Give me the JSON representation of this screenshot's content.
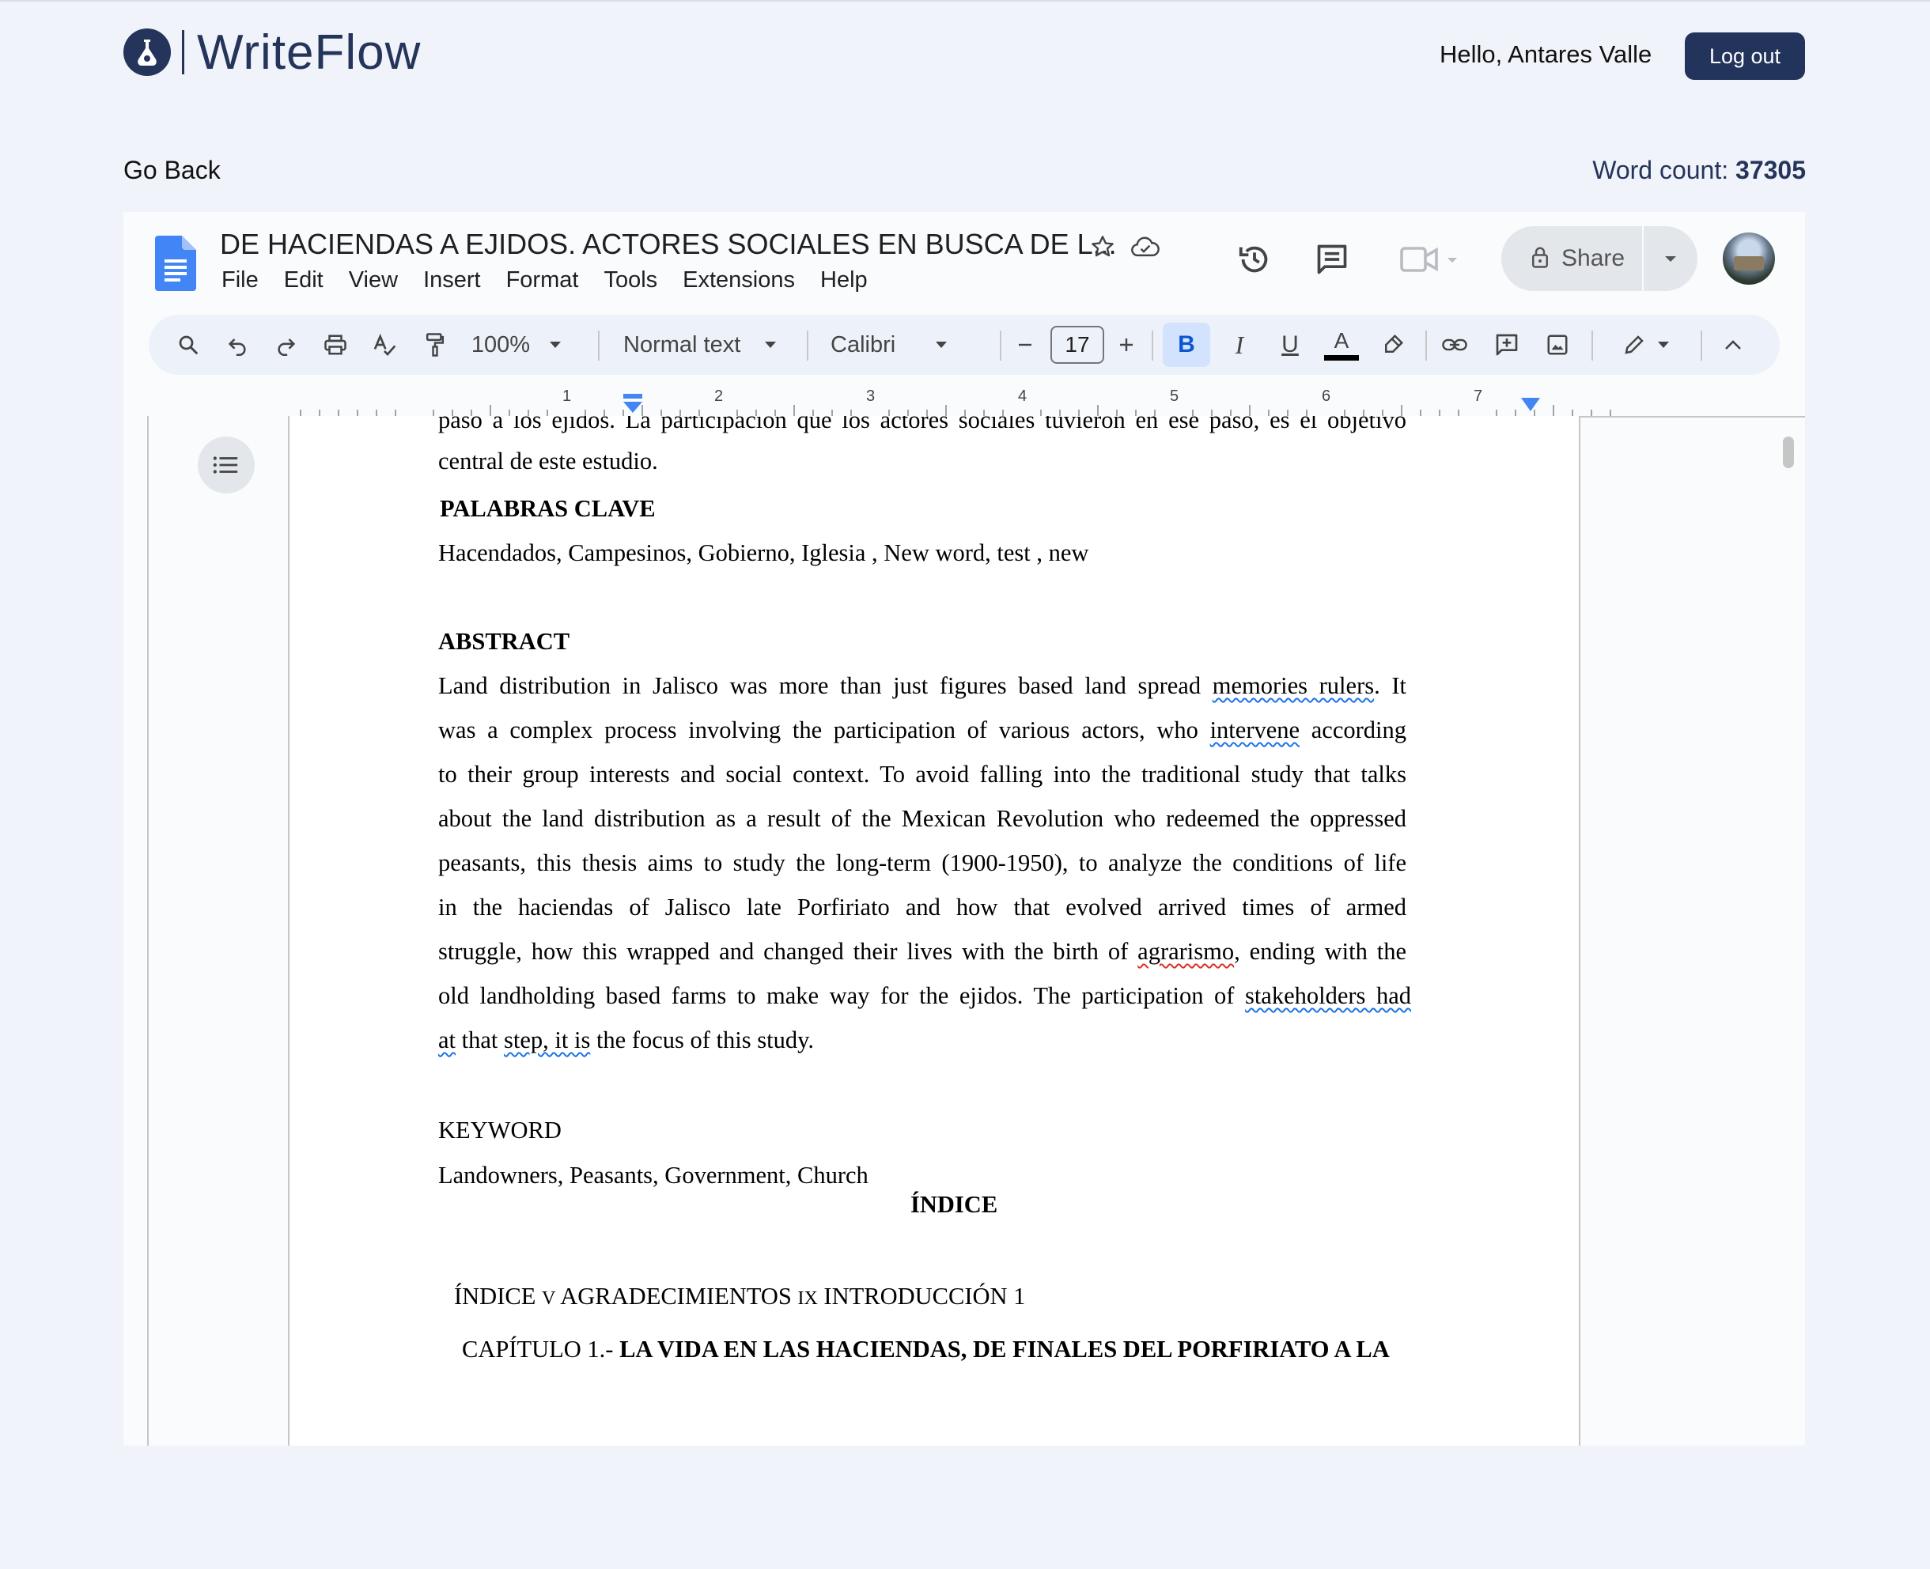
{
  "app": {
    "brand_name": "WriteFlow",
    "greeting": "Hello, Antares Valle",
    "logout_label": "Log out",
    "go_back_label": "Go Back",
    "word_count_label": "Word count:",
    "word_count_value": "37305"
  },
  "editor": {
    "doc_title": "DE HACIENDAS A EJIDOS. ACTORES SOCIALES EN BUSCA DE L...",
    "menu": [
      "File",
      "Edit",
      "View",
      "Insert",
      "Format",
      "Tools",
      "Extensions",
      "Help"
    ],
    "share_label": "Share",
    "toolbar": {
      "zoom": "100%",
      "style": "Normal text",
      "font": "Calibri",
      "font_size": "17"
    },
    "ruler_numbers": [
      "1",
      "2",
      "3",
      "4",
      "5",
      "6",
      "7"
    ],
    "icons": {
      "doc": "docs-file-icon",
      "star": "star-icon",
      "cloud": "cloud-saved-icon",
      "history": "version-history-icon",
      "comments": "comments-icon",
      "meet": "video-call-icon",
      "lock": "lock-icon",
      "outline": "document-outline-icon"
    },
    "colors": {
      "accent": "#1a73e8",
      "brand": "#24345a",
      "toolbar_bg": "#edf2fa",
      "bold_active": "#d3e3fd"
    }
  },
  "document": {
    "line_top_cut": "paso a los  ejidos. La participación que los actores sociales tuvieron en ese paso, es el objetivo",
    "line_central": "central de  este estudio.",
    "palabras_heading": "PALABRAS CLAVE",
    "palabras_text": "Hacendados, Campesinos, Gobierno, Iglesia , New word, test , new",
    "abstract_heading": "ABSTRACT",
    "abstract": {
      "l1_a": "Land distribution in Jalisco was more than just figures based land spread ",
      "l1_b": "memories rulers",
      "l1_c": ". It",
      "l2_a": "was a complex process involving the participation of various actors, who ",
      "l2_b": "intervene",
      "l2_c": " according",
      "l3": "to their group interests and social context. To avoid falling into the traditional study that talks",
      "l4": "about the land distribution as a result of the Mexican Revolution who redeemed the oppressed",
      "l5": "peasants, this thesis aims to study the long-term (1900-1950), to analyze the conditions of life",
      "l6": "in the haciendas of Jalisco late Porfiriato and how that evolved arrived times of armed",
      "l7_a": "struggle, how this wrapped and changed their lives with the birth of ",
      "l7_b": "agrarismo",
      "l7_c": ", ending with  the",
      "l8_a": "old landholding based farms to make way for the ejidos. The participation of ",
      "l8_b": "stakeholders  had",
      "l9_a": "at",
      "l9_b": " that ",
      "l9_c": "step, it is",
      "l9_d": " the focus of this study."
    },
    "keyword_heading": "KEYWORD",
    "keyword_text": "Landowners, Peasants, Government, Church",
    "indice_heading": "ÍNDICE",
    "toc_a": "ÍNDICE ",
    "toc_v": "V",
    "toc_b": " AGRADECIMIENTOS ",
    "toc_ix": "IX",
    "toc_c": " INTRODUCCIÓN 1",
    "cap_prefix": "CAPÍTULO 1.- ",
    "cap_title": "LA VIDA EN LAS HACIENDAS, DE FINALES DEL PORFIRIATO A LA"
  }
}
